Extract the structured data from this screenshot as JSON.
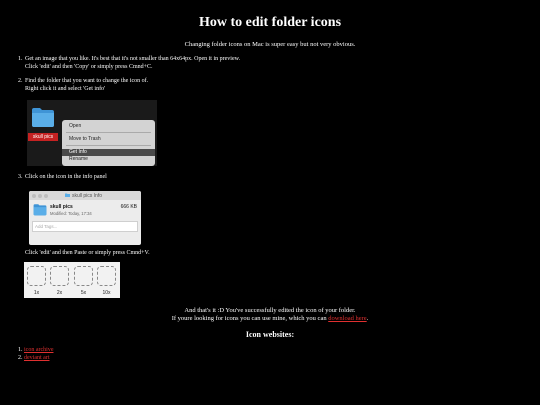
{
  "page": {
    "title": "How to edit folder icons",
    "subtitle": "Changing folder icons on Mac is super easy but not very obvious."
  },
  "steps": [
    {
      "num": "1.",
      "line1": "Get an image that you like. It's best that it's not smaller than 64x64px. Open it in preview.",
      "line2": "Click 'edit' and then 'Copy' or simply press Cmnd+C."
    },
    {
      "num": "2.",
      "line1": "Find the folder that you want to change the icon of.",
      "line2": "Right click it and select 'Get info'"
    },
    {
      "num": "3.",
      "line1": "Click on the icon in the info panel",
      "line2": ""
    }
  ],
  "paste_instruction": "Click 'edit' and then Paste or simply press Cmnd+V.",
  "context_menu": {
    "folder_label": "skull pics",
    "items": [
      "Open",
      "Move to Trash",
      "Get Info",
      "Rename"
    ],
    "selected": "Get Info"
  },
  "info_panel": {
    "window_title": "skull pics Info",
    "name": "skull pics",
    "size": "666 KB",
    "modified": "Modified: Today, 17:34",
    "tags_placeholder": "Add Tags..."
  },
  "icon_sizes": [
    "1x",
    "2x",
    "5x",
    "10x"
  ],
  "closing": {
    "line1": "And that's it :D You've successfully edited the icon of your folder.",
    "line2_prefix": "If youre looking for icons you can use mine, which you can ",
    "line2_link": "download here",
    "line2_suffix": "."
  },
  "icon_websites": {
    "heading": "Icon websites:",
    "items": [
      {
        "num": "1.",
        "label": "icon archive"
      },
      {
        "num": "2.",
        "label": "deviant art"
      }
    ]
  },
  "colors": {
    "background": "#000000",
    "text": "#ffffff",
    "link": "#e03030",
    "folder_blue": "#5aaee8",
    "label_red": "#c52222"
  }
}
